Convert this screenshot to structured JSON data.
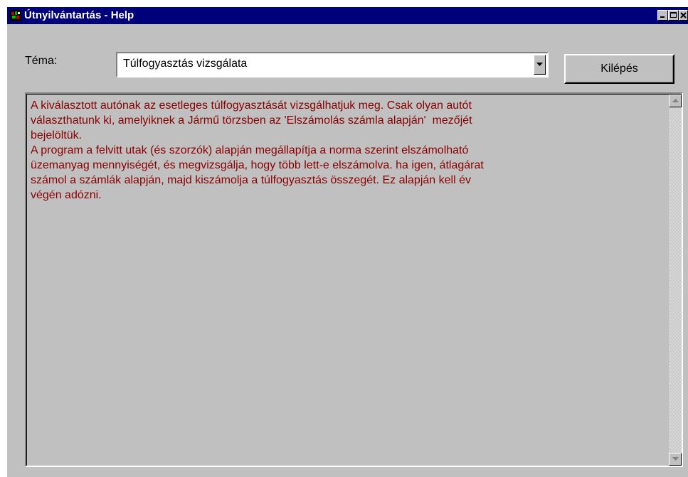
{
  "window": {
    "title": "Útnyilvántartás - Help",
    "controls": {
      "minimize": "_",
      "maximize": "□",
      "close": "×"
    }
  },
  "topic": {
    "label": "Téma:",
    "selected": "Túlfogyasztás vizsgálata"
  },
  "exit_button": {
    "label": "Kilépés"
  },
  "help_text": "A kiválasztott autónak az esetleges túlfogyasztását vizsgálhatjuk meg. Csak olyan autót\nválaszthatunk ki, amelyiknek a Jármű törzsben az 'Elszámolás számla alapján'  mezőjét\nbejelöltük.\nA program a felvitt utak (és szorzók) alapján megállapítja a norma szerint elszámolható\nüzemanyag mennyiségét, és megvizsgálja, hogy több lett-e elszámolva. ha igen, átlagárat\nszámol a számlák alapján, majd kiszámolja a túlfogyasztás összegét. Ez alapján kell év\nvégén adózni.",
  "colors": {
    "titlebar": "#00007b",
    "window_bg": "#c0c0c0",
    "help_text": "#8b0000"
  }
}
